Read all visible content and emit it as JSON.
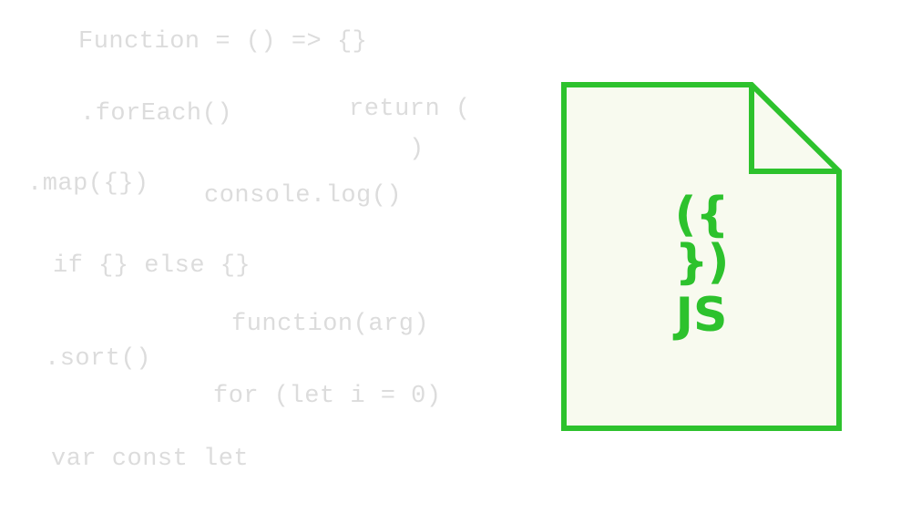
{
  "background_snippets": [
    "Function = () => {}",
    ".forEach()",
    "return (",
    ")",
    ".map({})",
    "console.log()",
    "if {} else {}",
    "function(arg)",
    ".sort()",
    "for (let i = 0)",
    "var const let"
  ],
  "file_icon": {
    "symbol": "({ })",
    "label": "JS",
    "stroke_color": "#2dc22d",
    "fill_color": "#f8faef",
    "icon_name": "javascript-file-icon"
  },
  "colors": {
    "snippet_text": "#dcdcdc",
    "accent": "#2dc22d",
    "background": "#ffffff"
  }
}
